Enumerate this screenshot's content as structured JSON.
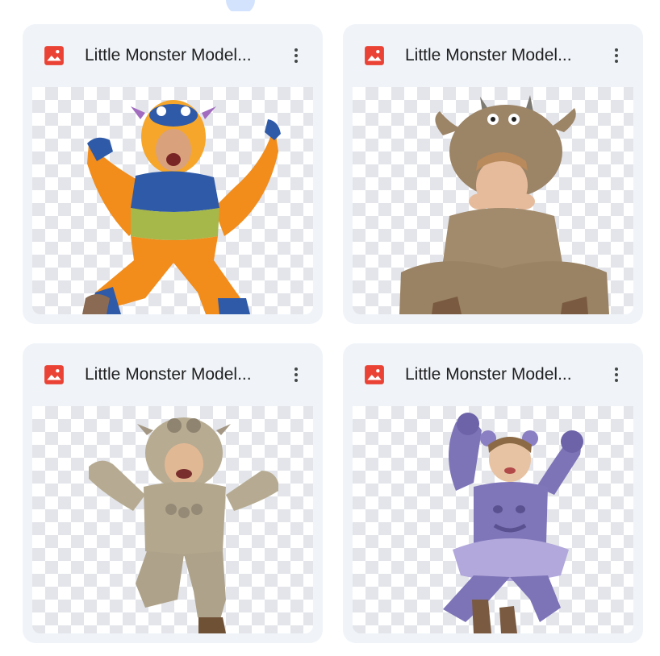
{
  "files": [
    {
      "name": "Little Monster Model...",
      "type_icon": "image-file-icon",
      "subject": "kid in orange and blue striped monster costume"
    },
    {
      "name": "Little Monster Model...",
      "type_icon": "image-file-icon",
      "subject": "kid in brown furry monster costume sitting"
    },
    {
      "name": "Little Monster Model...",
      "type_icon": "image-file-icon",
      "subject": "kid in beige furry monster costume jumping"
    },
    {
      "name": "Little Monster Model...",
      "type_icon": "image-file-icon",
      "subject": "girl in purple furry monster costume jumping"
    }
  ],
  "colors": {
    "card_bg": "#f0f4f9",
    "image_icon": "#ea4335",
    "title_text": "#1f1f1f"
  }
}
